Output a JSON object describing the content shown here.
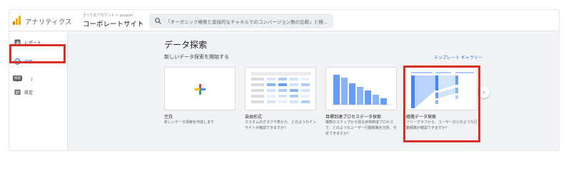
{
  "header": {
    "app_title": "アナリティクス",
    "account_path": "すべてのアカウント > pluspm",
    "property_name": "コーポレートサイト",
    "property_caret": "▾",
    "search_placeholder": "「オーガニック検索と直接的なチャネルでのコンバージョン数の比較」と検..."
  },
  "sidebar": {
    "items": [
      {
        "label": "レポート",
        "icon": "bar-chart-icon"
      },
      {
        "label": "探索",
        "icon": "explore-icon",
        "active": true
      },
      {
        "label": "広告",
        "icon": "ads-icon"
      },
      {
        "label": "設定",
        "icon": "settings-icon"
      }
    ],
    "tooltip": "探索"
  },
  "main": {
    "page_title": "データ探索",
    "section_title": "新しいデータ探索を開始する",
    "gallery_link": "テンプレート ギャラリー",
    "next_arrow": "›",
    "cards": [
      {
        "name": "空白",
        "desc": "新しいデータ探索を作成します"
      },
      {
        "name": "自由形式",
        "desc": "カスタムのグラフや表から、どのようなインサイトが確認できますか？"
      },
      {
        "name": "目標到達プロセスデータ探索",
        "desc": "複数のステップから成る目標到達プロセスで、どのようなユーザー行動経路を分析、分析できますか？"
      },
      {
        "name": "経路データ探索",
        "desc": "ツリーグラフから、ユーザーのどのような行動経路が確認できますか？"
      }
    ]
  },
  "colors": {
    "accent_blue": "#1a73e8",
    "highlight_red": "#d93025",
    "logo_orange": "#f9ab00",
    "logo_dark_orange": "#e37400"
  }
}
